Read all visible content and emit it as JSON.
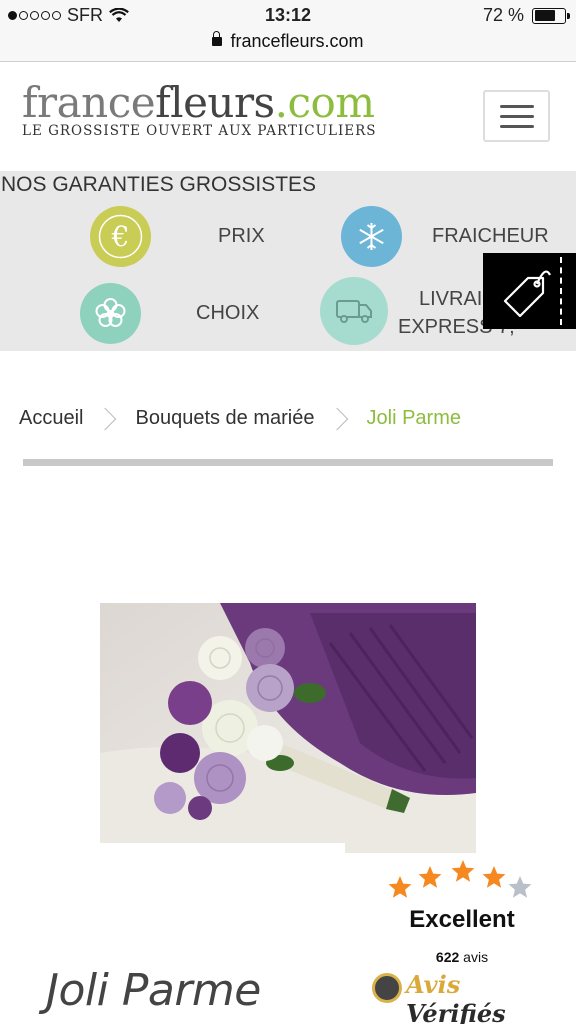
{
  "status_bar": {
    "carrier": "SFR",
    "signal_bars_filled": 1,
    "signal_bars_total": 5,
    "time": "13:12",
    "battery_text": "72 %",
    "battery_level": 0.72,
    "url": "francefleurs.com"
  },
  "header": {
    "logo_part1": "france",
    "logo_part2": "fleurs",
    "logo_part3": ".com",
    "tagline": "LE GROSSISTE OUVERT AUX PARTICULIERS",
    "menu_icon": "hamburger-icon"
  },
  "guarantees": {
    "title": "NOS GARANTIES GROSSISTES",
    "items": [
      {
        "label": "PRIX",
        "icon": "euro-icon",
        "color": "#c9cc55"
      },
      {
        "label": "FRAICHEUR",
        "icon": "snowflake-icon",
        "color": "#6cb5d6"
      },
      {
        "label": "CHOIX",
        "icon": "flower-icon",
        "color": "#8ed1bd"
      },
      {
        "label_line1": "LIVRAI",
        "label_line2": "EXPRESS 7,",
        "icon": "truck-icon",
        "color": "#a6dccf"
      }
    ],
    "tag_icon": "price-tag-icon"
  },
  "breadcrumb": {
    "items": [
      "Accueil",
      "Bouquets de mariée"
    ],
    "current": "Joli Parme"
  },
  "product": {
    "title": "Joli Parme",
    "image": "bridal-bouquet-purple-white-roses"
  },
  "reviews": {
    "rating": 4.5,
    "max_rating": 5,
    "label": "Excellent",
    "count": "622",
    "count_suffix": "avis",
    "brand_part1": "Avis",
    "brand_part2": "Vérifiés",
    "star_color": "#f5891f",
    "brand_color": "#d9a93a"
  },
  "colors": {
    "accent_green": "#8cbd3e",
    "guarantee_bg": "#e8e8e8"
  }
}
